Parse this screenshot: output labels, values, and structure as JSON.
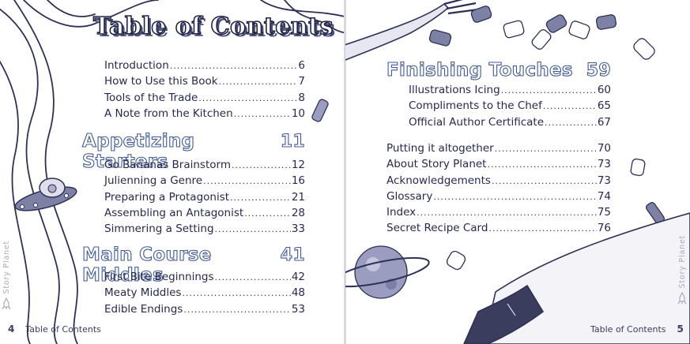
{
  "left_page": {
    "title": "Table of Contents",
    "front_matter": [
      {
        "title": "Introduction",
        "page": "6"
      },
      {
        "title": "How to Use this Book",
        "page": "7"
      },
      {
        "title": "Tools of the Trade",
        "page": "8"
      },
      {
        "title": "A Note from the Kitchen",
        "page": "10"
      }
    ],
    "sections": [
      {
        "heading": "Appetizing Starters",
        "page": "11",
        "entries": [
          {
            "title": "Go Bananas Brainstorm",
            "page": "12"
          },
          {
            "title": "Julienning a Genre",
            "page": "16"
          },
          {
            "title": "Preparing a Protagonist",
            "page": "21"
          },
          {
            "title": "Assembling an Antagonist",
            "page": "28"
          },
          {
            "title": "Simmering a Setting",
            "page": "33"
          }
        ]
      },
      {
        "heading": "Main Course Middles",
        "page": "41",
        "entries": [
          {
            "title": "First Bite Beginnings",
            "page": "42"
          },
          {
            "title": "Meaty Middles",
            "page": "48"
          },
          {
            "title": "Edible Endings",
            "page": "53"
          }
        ]
      }
    ],
    "footer": {
      "page_number": "4",
      "label": "Table of Contents"
    },
    "side_brand": "Story Planet"
  },
  "right_page": {
    "section": {
      "heading": "Finishing Touches",
      "page": "59",
      "entries": [
        {
          "title": "Illustrations Icing",
          "page": "60"
        },
        {
          "title": "Compliments to the Chef",
          "page": "65"
        },
        {
          "title": "Official Author Certificate",
          "page": "67"
        }
      ]
    },
    "back_matter": [
      {
        "title": "Putting it altogether",
        "page": "70"
      },
      {
        "title": "About Story Planet",
        "page": "73"
      },
      {
        "title": "Acknowledgements",
        "page": "73"
      },
      {
        "title": "Glossary",
        "page": "74"
      },
      {
        "title": "Index",
        "page": "75"
      },
      {
        "title": "Secret Recipe Card",
        "page": "76"
      }
    ],
    "footer": {
      "page_number": "5",
      "label": "Table of Contents"
    },
    "side_brand": "Story Planet"
  },
  "icons": [
    "noodle-ribbons",
    "ufo-alien-icon",
    "fork-icon",
    "pasta-pieces",
    "ringed-planet-icon",
    "knife-icon",
    "rocket-logo-icon"
  ],
  "colors": {
    "ink": "#26294f",
    "heading_outline": "#3f5a96",
    "planet": "#9a9cc0",
    "gutter": "#c9cad4"
  }
}
